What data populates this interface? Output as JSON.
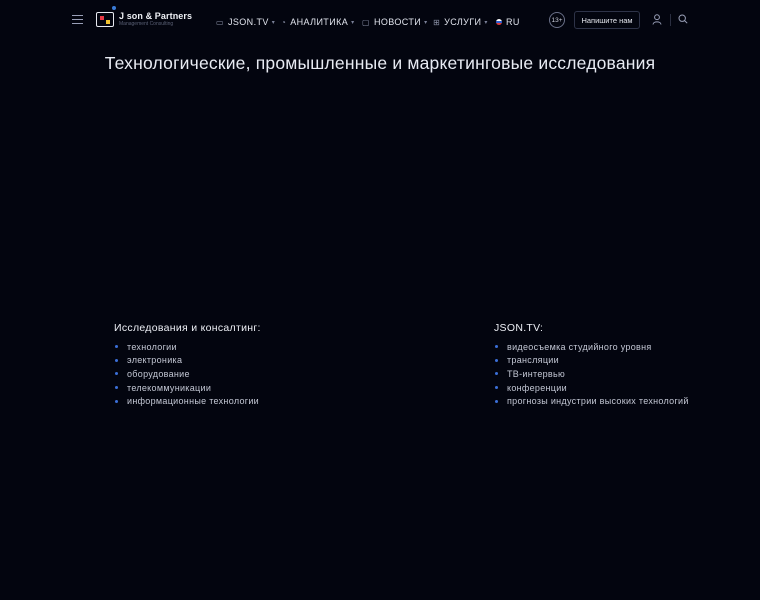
{
  "header": {
    "logo_name": "J son & Partners",
    "logo_sub": "Management Consulting",
    "nav": [
      {
        "label": "JSON.TV",
        "icon": "tv-icon",
        "has_dropdown": true
      },
      {
        "label": "АНАЛИТИКА",
        "icon": "chart-icon",
        "has_dropdown": true
      },
      {
        "label": "НОВОСТИ",
        "icon": "news-icon",
        "has_dropdown": true
      },
      {
        "label": "УСЛУГИ",
        "icon": "grid-icon",
        "has_dropdown": true
      },
      {
        "label": "RU",
        "icon": "flag-icon",
        "has_dropdown": false
      }
    ],
    "age_rating": "13+",
    "contact_label": "Напишите нам"
  },
  "main": {
    "title": "Технологические, промышленные и маркетинговые исследования",
    "columns": [
      {
        "heading": "Исследования и консалтинг:",
        "items": [
          "технологии",
          "электроника",
          "оборудование",
          "телекоммуникации",
          "информационные технологии"
        ]
      },
      {
        "heading": "JSON.TV:",
        "items": [
          "видеосъемка студийного уровня",
          "трансляции",
          "ТВ-интервью",
          "конференции",
          "прогнозы индустрии высоких технологий"
        ]
      }
    ]
  },
  "colors": {
    "background": "#03050f",
    "accent": "#3b6fd8",
    "text": "#e8ebf3"
  }
}
